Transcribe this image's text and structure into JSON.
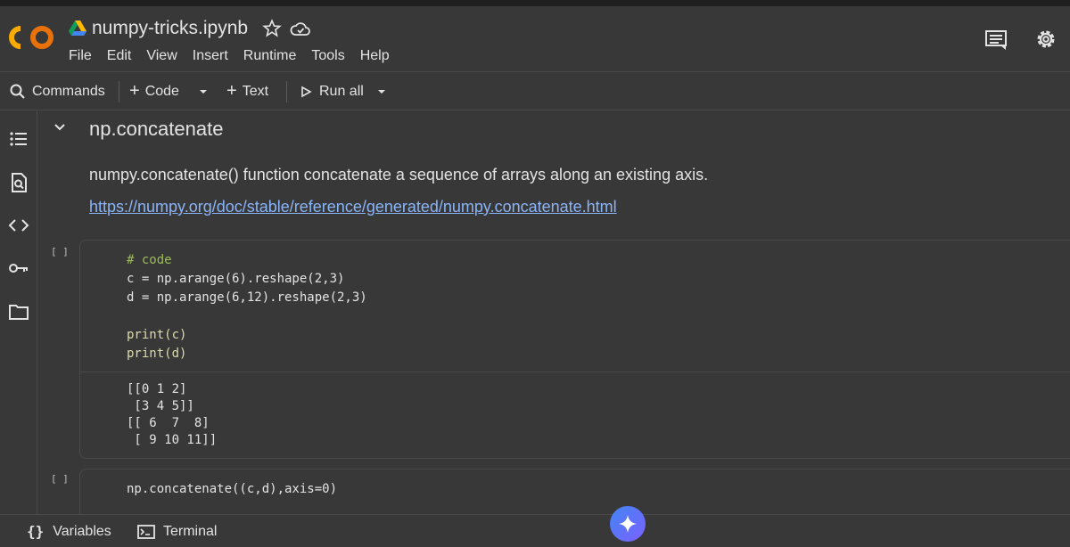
{
  "header": {
    "title": "numpy-tricks.ipynb",
    "logo_text": "CO",
    "menu": [
      "File",
      "Edit",
      "View",
      "Insert",
      "Runtime",
      "Tools",
      "Help"
    ]
  },
  "toolbar": {
    "commands": "Commands",
    "code": "Code",
    "text": "Text",
    "run_all": "Run all"
  },
  "section": {
    "heading": "np.concatenate",
    "description": "numpy.concatenate() function concatenate a sequence of arrays along an existing axis.",
    "link": "https://numpy.org/doc/stable/reference/generated/numpy.concatenate.html"
  },
  "cells": [
    {
      "bracket": "[ ]",
      "code_lines": [
        "# code",
        "c = np.arange(6).reshape(2,3)",
        "d = np.arange(6,12).reshape(2,3)",
        "",
        "print(c)",
        "print(d)"
      ],
      "output_lines": [
        "[[0 1 2]",
        " [3 4 5]]",
        "[[ 6  7  8]",
        " [ 9 10 11]]"
      ]
    },
    {
      "bracket": "[ ]",
      "code_lines": [
        "np.concatenate((c,d),axis=0)"
      ]
    }
  ],
  "statusbar": {
    "variables": "Variables",
    "terminal": "Terminal"
  },
  "colors": {
    "background": "#383838",
    "link": "#8ab4f8",
    "logo_orange": "#f9ab00",
    "logo_dark_orange": "#e8710a"
  }
}
